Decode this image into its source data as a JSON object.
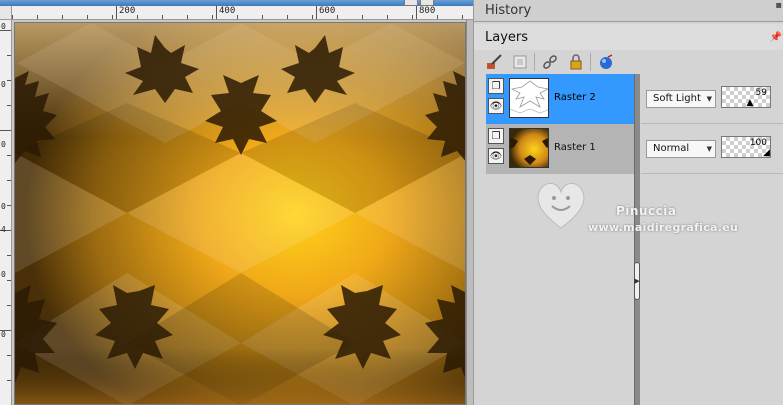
{
  "rulers": {
    "horizontal": [
      "200",
      "400",
      "600",
      "800"
    ],
    "vertical": [
      "0",
      "0",
      "0",
      "0",
      "4",
      "0",
      "0"
    ]
  },
  "panels": {
    "history": {
      "title": "History"
    },
    "layers": {
      "title": "Layers"
    }
  },
  "toolbar": {
    "tools": [
      "brush-icon",
      "new-layer-icon",
      "link-icon",
      "lock-icon",
      "globe-icon"
    ]
  },
  "layers": [
    {
      "name": "Raster 2",
      "blend_mode": "Soft Light",
      "opacity": "59",
      "opacity_fraction": 0.59,
      "selected": true
    },
    {
      "name": "Raster 1",
      "blend_mode": "Normal",
      "opacity": "100",
      "opacity_fraction": 1.0,
      "selected": false
    }
  ],
  "watermark": {
    "name": "Pinuccia",
    "url": "www.maidiregrafica.eu"
  },
  "colors": {
    "selection": "#3399ff",
    "canvas_gold": "#f0b020",
    "canvas_dark": "#3a2806"
  }
}
